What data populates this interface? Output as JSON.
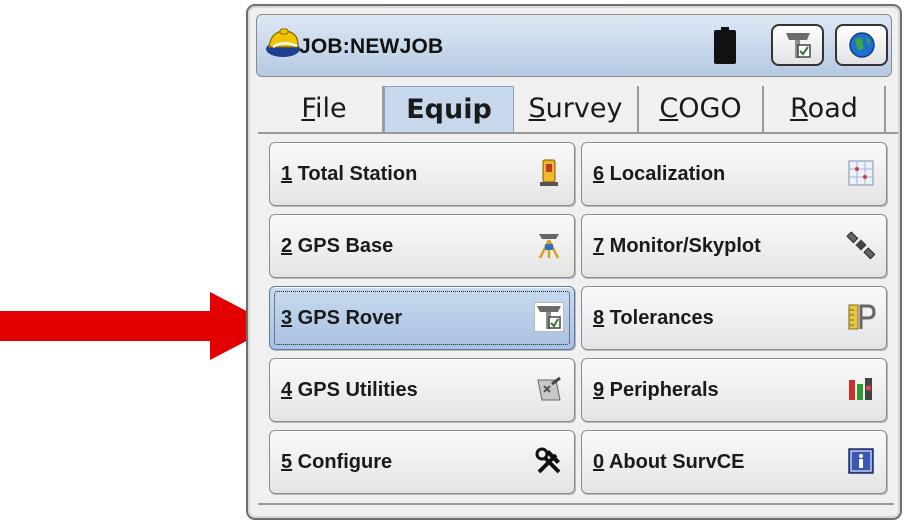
{
  "titlebar": {
    "title": "JOB:NEWJOB",
    "app_icon": "surveyor-hardhat-icon",
    "battery_icon": "battery-icon",
    "rover_icon": "gps-rover-icon",
    "globe_icon": "globe-icon"
  },
  "tabs": [
    {
      "key": "F",
      "rest": "ile",
      "active": false
    },
    {
      "key": "",
      "rest": "Equip",
      "active": true
    },
    {
      "key": "S",
      "rest": "urvey",
      "active": false
    },
    {
      "key": "C",
      "rest": "OGO",
      "active": false
    },
    {
      "key": "R",
      "rest": "oad",
      "active": false
    }
  ],
  "menu": {
    "left": [
      {
        "num": "1",
        "label": " Total Station",
        "icon": "total-station-icon"
      },
      {
        "num": "2",
        "label": " GPS Base",
        "icon": "gps-base-icon"
      },
      {
        "num": "3",
        "label": " GPS Rover",
        "icon": "gps-rover-icon",
        "selected": true
      },
      {
        "num": "4",
        "label": " GPS Utilities",
        "icon": "gps-utilities-icon"
      },
      {
        "num": "5",
        "label": " Configure",
        "icon": "hammer-wrench-icon"
      }
    ],
    "right": [
      {
        "num": "6",
        "label": " Localization",
        "icon": "localization-grid-icon"
      },
      {
        "num": "7",
        "label": " Monitor/Skyplot",
        "icon": "satellite-icon"
      },
      {
        "num": "8",
        "label": " Tolerances",
        "icon": "tolerances-icon"
      },
      {
        "num": "9",
        "label": " Peripherals",
        "icon": "peripherals-icon"
      },
      {
        "num": "0",
        "label": " About SurvCE",
        "icon": "info-icon"
      }
    ]
  },
  "colors": {
    "arrow": "#e30000",
    "selected_button": "#b6cbe6",
    "active_tab": "#c8d8ec"
  }
}
